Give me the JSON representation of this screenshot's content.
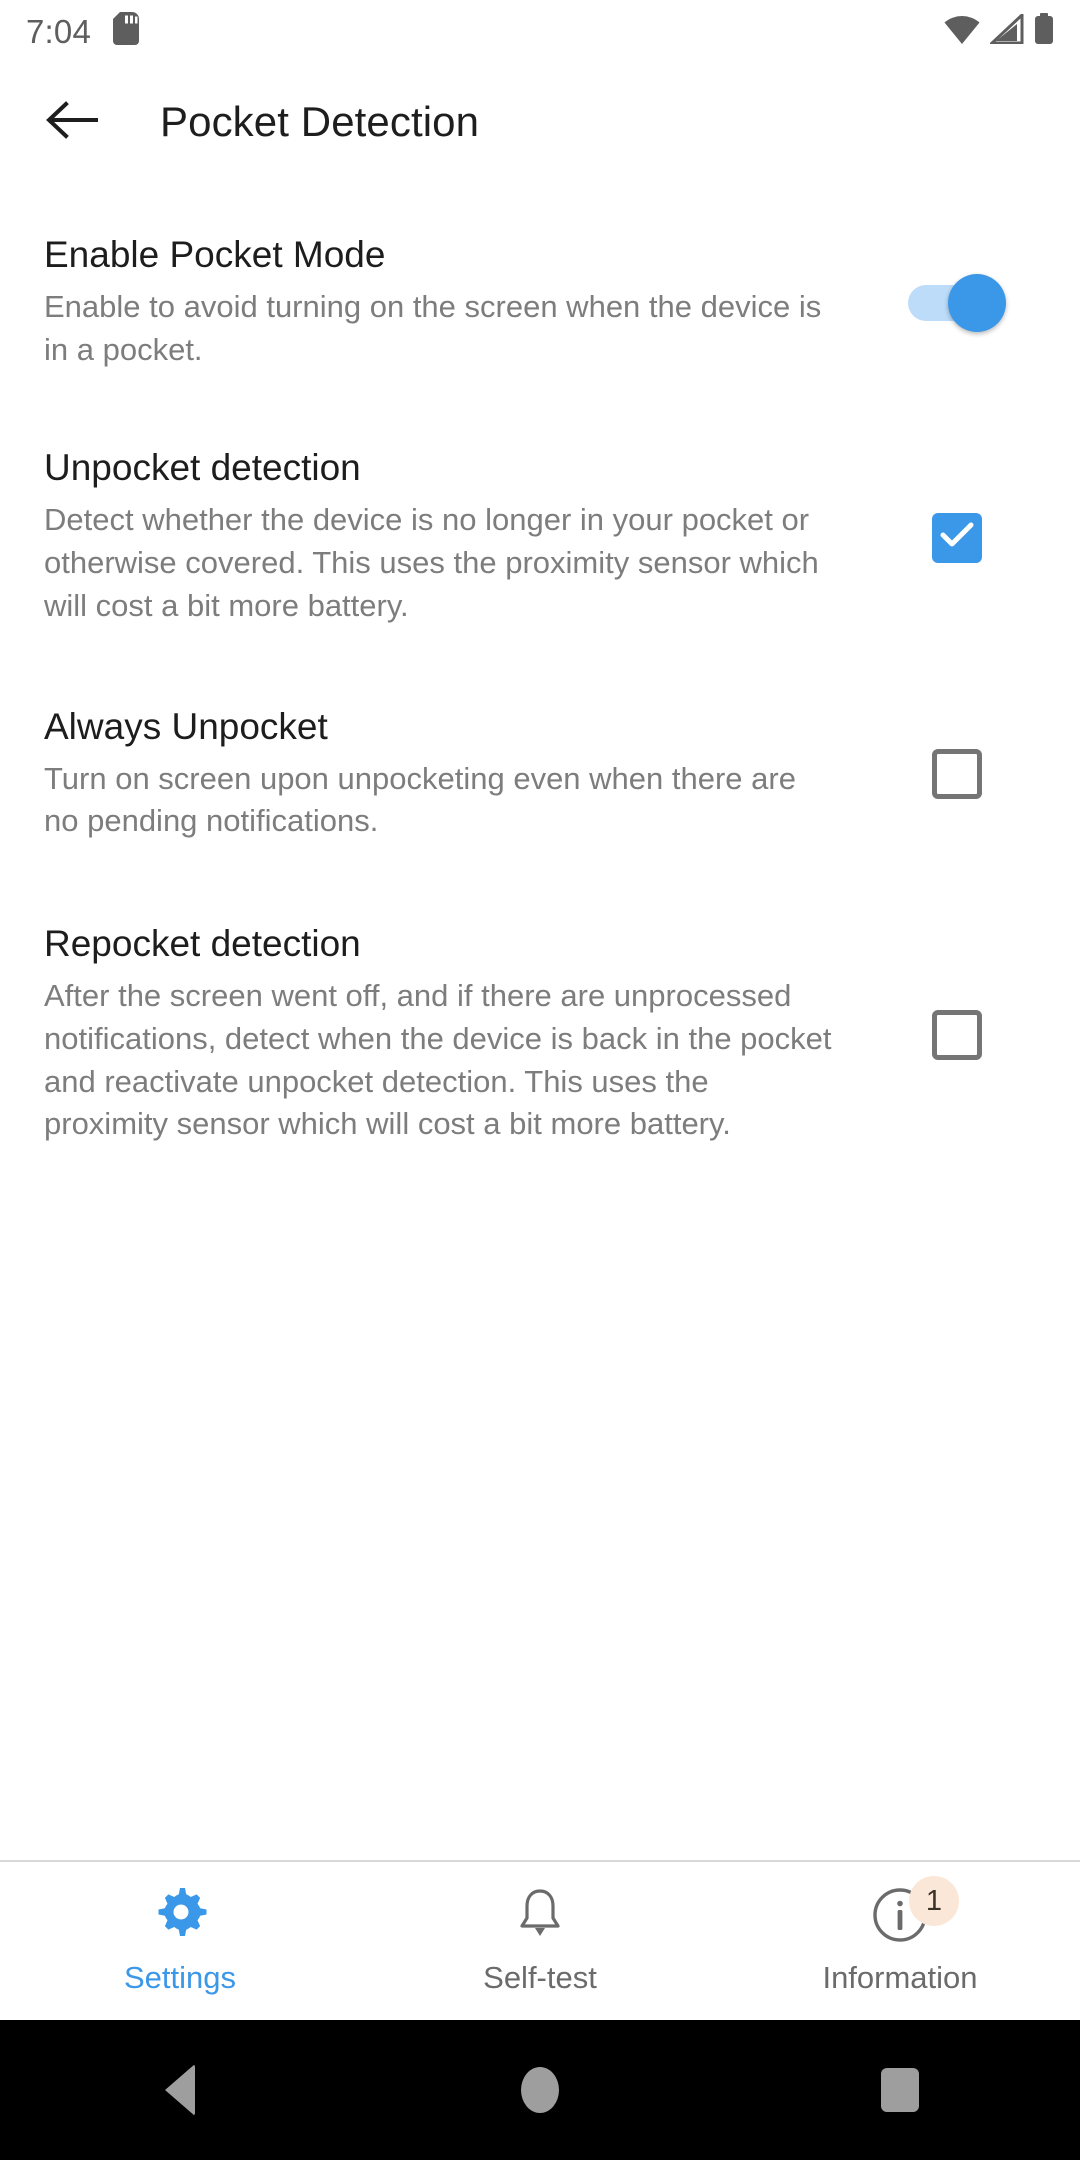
{
  "status_bar": {
    "time": "7:04",
    "icons": [
      "sd-card-icon",
      "wifi-icon",
      "cellular-signal-icon",
      "battery-icon"
    ]
  },
  "app_bar": {
    "back_icon": "back-arrow-icon",
    "title": "Pocket Detection"
  },
  "colors": {
    "accent": "#3b97e8",
    "track": "#bcdcfa",
    "title_text": "#1d1d1d",
    "summary_text": "#7d7d7d",
    "checkbox_border": "#757575",
    "badge_bg": "#fbe7d8"
  },
  "preferences": [
    {
      "title": "Enable Pocket Mode",
      "summary": "Enable to avoid turning on the screen when the device is in a pocket.",
      "control": "switch",
      "state": "on"
    },
    {
      "title": "Unpocket detection",
      "summary": "Detect whether the device is no longer in your pocket or otherwise covered. This uses the proximity sensor which will cost a bit more battery.",
      "control": "checkbox",
      "state": "checked"
    },
    {
      "title": "Always Unpocket",
      "summary": "Turn on screen upon unpocketing even when there are no pending notifications.",
      "control": "checkbox",
      "state": "unchecked"
    },
    {
      "title": "Repocket detection",
      "summary": "After the screen went off, and if there are unprocessed notifications, detect when the device is back in the pocket and reactivate unpocket detection. This uses the proximity sensor which will cost a bit more battery.",
      "control": "checkbox",
      "state": "unchecked"
    }
  ],
  "bottom_nav": {
    "items": [
      {
        "label": "Settings",
        "icon": "gear-icon",
        "active": true,
        "badge": ""
      },
      {
        "label": "Self-test",
        "icon": "bell-icon",
        "active": false,
        "badge": ""
      },
      {
        "label": "Information",
        "icon": "info-circle-icon",
        "active": false,
        "badge": "1"
      }
    ]
  },
  "system_nav": {
    "back": "back-triangle-icon",
    "home": "home-circle-icon",
    "recents": "recents-square-icon"
  }
}
